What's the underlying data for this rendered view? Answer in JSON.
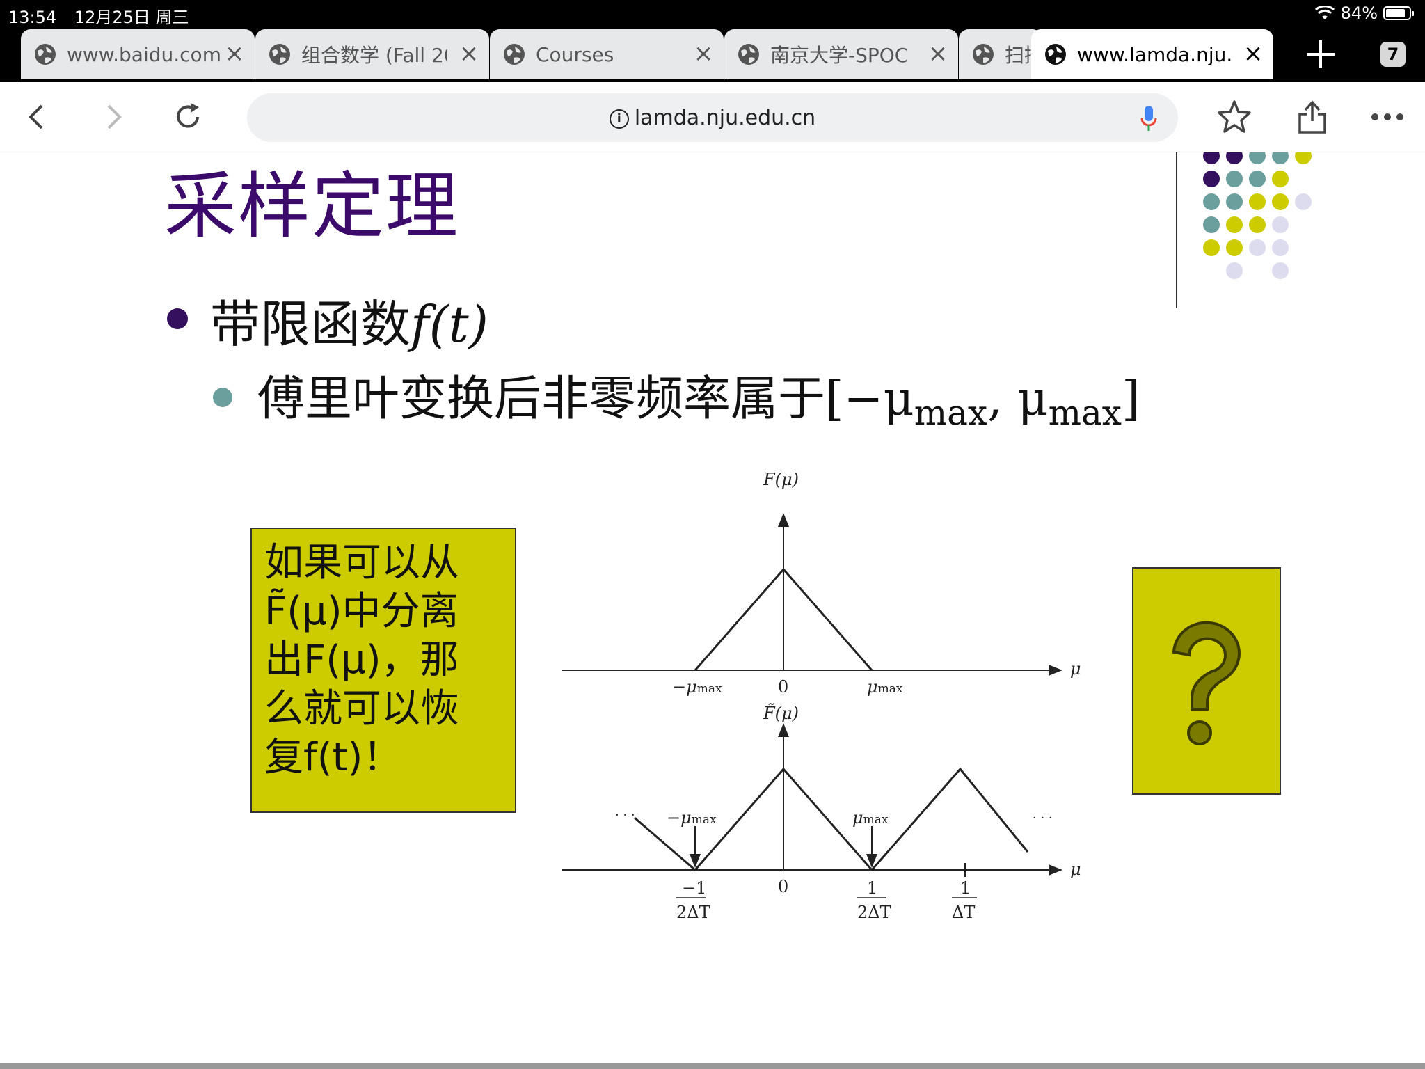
{
  "status": {
    "time": "13:54",
    "date": "12月25日 周三",
    "battery": "84%",
    "battery_level": 0.84
  },
  "tabs": [
    {
      "label": "www.baidu.com",
      "active": false
    },
    {
      "label": "组合数学 (Fall 20",
      "active": false
    },
    {
      "label": "Courses",
      "active": false
    },
    {
      "label": "南京大学-SPOC",
      "active": false
    },
    {
      "label": "扫描",
      "active": false
    },
    {
      "label": "www.lamda.nju.",
      "active": true
    }
  ],
  "tab_count": "7",
  "address": {
    "url": "lamda.nju.edu.cn"
  },
  "slide": {
    "title": "采样定理",
    "bullet1_text": "带限函数",
    "bullet1_math": "f(t)",
    "bullet2_text": "傅里叶变换后非零频率属于[−μ",
    "bullet2_sub1": "max",
    "bullet2_mid": ", μ",
    "bullet2_sub2": "max",
    "bullet2_end": "]",
    "box_lines": [
      "如果可以从",
      "F̃(μ)中分离",
      "出F(μ)，那",
      "么就可以恢",
      "复f(t)！"
    ],
    "question": "?"
  },
  "figure": {
    "top_label": "F(μ)",
    "bottom_label": "F̃(μ)",
    "axis_label": "μ",
    "neg_mu": "−μ",
    "pos_mu": "μ",
    "max_sub": "max",
    "zero": "0",
    "ellipsis": "· · ·",
    "tick_neg_num": "−1",
    "tick_den": "2ΔT",
    "tick_one": "1",
    "tick_dT": "ΔT"
  },
  "colors": {
    "title": "#3b0a6b",
    "purple_dot": "#35105f",
    "teal_dot": "#6a9f9e",
    "yellow": "#cccc00",
    "lavender": "#dcdcee",
    "qmark": "#7a7a00"
  }
}
